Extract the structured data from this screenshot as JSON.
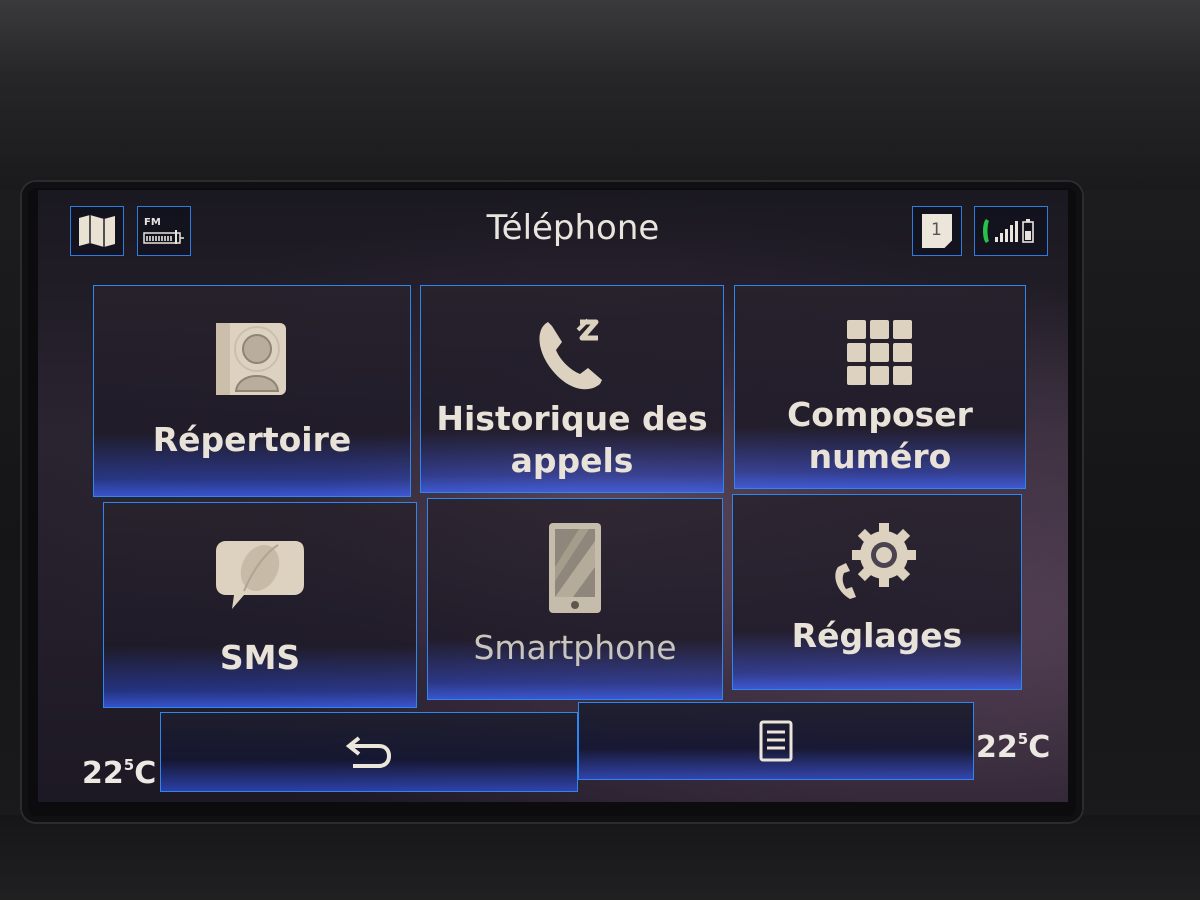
{
  "header": {
    "title": "Téléphone",
    "map_icon": "map-icon",
    "radio_icon": "fm-radio-icon",
    "radio_label": "FM",
    "notification_count": "1",
    "signal_icon": "phone-signal-battery-icon"
  },
  "tiles": [
    {
      "label": "Répertoire",
      "icon": "contacts-book-icon"
    },
    {
      "label_line1": "Historique des",
      "label_line2": "appels",
      "icon": "call-history-icon"
    },
    {
      "label_line1": "Composer",
      "label_line2": "numéro",
      "icon": "dial-pad-icon"
    },
    {
      "label": "SMS",
      "icon": "sms-bubbles-icon"
    },
    {
      "label": "Smartphone",
      "icon": "smartphone-icon",
      "state": "disabled"
    },
    {
      "label": "Réglages",
      "icon": "phone-settings-gear-icon"
    }
  ],
  "footer": {
    "back_icon": "back-arrow-icon",
    "menu_icon": "list-menu-icon",
    "temp_left_main": "22",
    "temp_left_dec": "5",
    "temp_left_unit": "C",
    "temp_right_main": "22",
    "temp_right_dec": "5",
    "temp_right_unit": "C"
  },
  "colors": {
    "accent_border": "#2e86f0",
    "glow_blue": "#3c64ff",
    "text": "#e8e2d8",
    "call_green": "#27c24a"
  }
}
